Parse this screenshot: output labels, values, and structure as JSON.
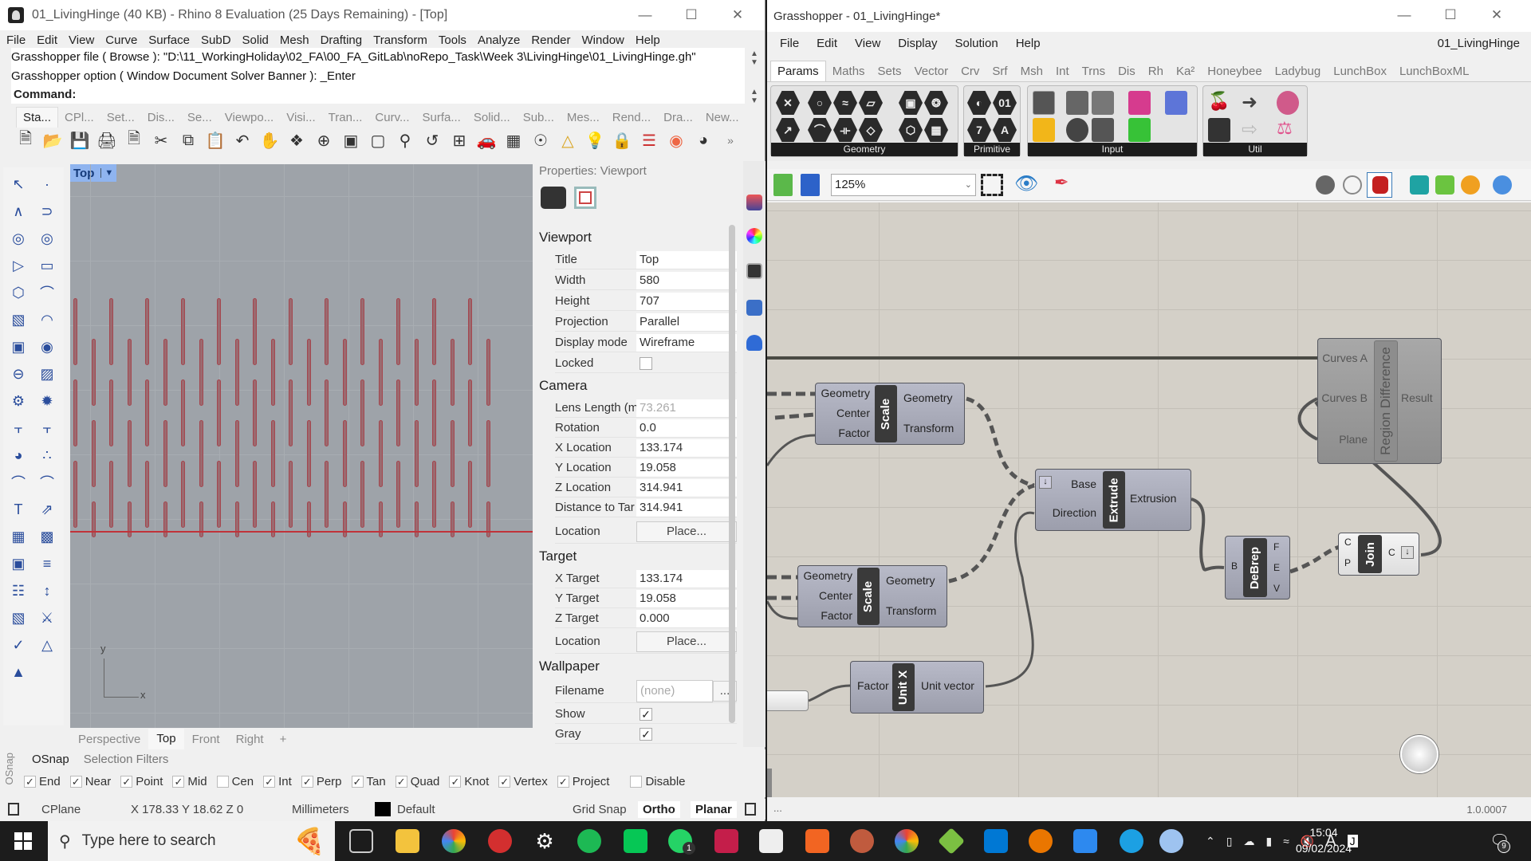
{
  "rhino": {
    "title": "01_LivingHinge (40 KB) - Rhino 8 Evaluation (25 Days Remaining) - [Top]",
    "menu": [
      "File",
      "Edit",
      "View",
      "Curve",
      "Surface",
      "SubD",
      "Solid",
      "Mesh",
      "Drafting",
      "Transform",
      "Tools",
      "Analyze",
      "Render",
      "Window",
      "Help"
    ],
    "command_history": [
      "Grasshopper file ( Browse ): \"D:\\11_WorkingHoliday\\02_FA\\00_FA_GitLab\\noRepo_Task\\Week 3\\LivingHinge\\01_LivingHinge.gh\"",
      "Grasshopper option ( Window  Document  Solver  Banner ): _Enter"
    ],
    "command_prompt": "Command:",
    "toolbar_tabs": [
      "Sta...",
      "CPl...",
      "Set...",
      "Dis...",
      "Se...",
      "Viewpo...",
      "Visi...",
      "Tran...",
      "Curv...",
      "Surfa...",
      "Solid...",
      "Sub...",
      "Mes...",
      "Rend...",
      "Dra...",
      "New..."
    ],
    "viewport": {
      "label": "Top",
      "axis_x": "x",
      "axis_y": "y"
    },
    "viewport_tabs": [
      "Perspective",
      "Top",
      "Front",
      "Right",
      "+"
    ],
    "properties": {
      "header": "Properties: Viewport",
      "sections": {
        "viewport": "Viewport",
        "camera": "Camera",
        "target": "Target",
        "wallpaper": "Wallpaper"
      },
      "title_label": "Title",
      "title": "Top",
      "width_label": "Width",
      "width": "580",
      "height_label": "Height",
      "height": "707",
      "projection_label": "Projection",
      "projection": "Parallel",
      "display_mode_label": "Display mode",
      "display_mode": "Wireframe",
      "locked_label": "Locked",
      "locked": false,
      "lens_label": "Lens Length (m",
      "lens": "73.261",
      "rotation_label": "Rotation",
      "rotation": "0.0",
      "xloc_label": "X Location",
      "xloc": "133.174",
      "yloc_label": "Y Location",
      "yloc": "19.058",
      "zloc_label": "Z Location",
      "zloc": "314.941",
      "dist_label": "Distance to Tar",
      "dist": "314.941",
      "location_label": "Location",
      "place": "Place...",
      "xt_label": "X Target",
      "xt": "133.174",
      "yt_label": "Y Target",
      "yt": "19.058",
      "zt_label": "Z Target",
      "zt": "0.000",
      "filename_label": "Filename",
      "filename": "(none)",
      "browse": "...",
      "show_label": "Show",
      "show": true,
      "gray_label": "Gray",
      "gray": true
    },
    "osnap": {
      "side_label": "OSnap",
      "tabs": [
        "OSnap",
        "Selection Filters"
      ],
      "items": [
        {
          "label": "End",
          "checked": true
        },
        {
          "label": "Near",
          "checked": true
        },
        {
          "label": "Point",
          "checked": true
        },
        {
          "label": "Mid",
          "checked": true
        },
        {
          "label": "Cen",
          "checked": false
        },
        {
          "label": "Int",
          "checked": true
        },
        {
          "label": "Perp",
          "checked": true
        },
        {
          "label": "Tan",
          "checked": true
        },
        {
          "label": "Quad",
          "checked": true
        },
        {
          "label": "Knot",
          "checked": true
        },
        {
          "label": "Vertex",
          "checked": true
        },
        {
          "label": "Project",
          "checked": true
        },
        {
          "label": "Disable",
          "checked": false
        }
      ]
    },
    "status": {
      "cplane": "CPlane",
      "coords": "X 178.33 Y 18.62 Z 0",
      "units": "Millimeters",
      "layer": "Default",
      "grid_snap": "Grid Snap",
      "ortho": "Ortho",
      "planar": "Planar"
    }
  },
  "grasshopper": {
    "title": "Grasshopper - 01_LivingHinge*",
    "menu": [
      "File",
      "Edit",
      "View",
      "Display",
      "Solution",
      "Help"
    ],
    "document_name": "01_LivingHinge",
    "tabs": [
      "Params",
      "Maths",
      "Sets",
      "Vector",
      "Crv",
      "Srf",
      "Msh",
      "Int",
      "Trns",
      "Dis",
      "Rh",
      "Ka²",
      "Honeybee",
      "Ladybug",
      "LunchBox",
      "LunchBoxML"
    ],
    "ribbon_groups": [
      "Geometry",
      "Primitive",
      "Input",
      "Util"
    ],
    "zoom": "125%",
    "components": {
      "scale1": {
        "name": "Scale",
        "inputs": [
          "Geometry",
          "Center",
          "Factor"
        ],
        "outputs": [
          "Geometry",
          "Transform"
        ]
      },
      "scale2": {
        "name": "Scale",
        "inputs": [
          "Geometry",
          "Center",
          "Factor"
        ],
        "outputs": [
          "Geometry",
          "Transform"
        ]
      },
      "extrude": {
        "name": "Extrude",
        "inputs": [
          "Base",
          "Direction"
        ],
        "outputs": [
          "Extrusion"
        ]
      },
      "unitx": {
        "name": "Unit X",
        "inputs": [
          "Factor"
        ],
        "outputs": [
          "Unit vector"
        ]
      },
      "regiondiff": {
        "name": "Region Difference",
        "inputs": [
          "Curves A",
          "Curves B",
          "Plane"
        ],
        "outputs": [
          "Result"
        ]
      },
      "debrep": {
        "name": "DeBrep",
        "inputs": [
          "B"
        ],
        "outputs": [
          "F",
          "E",
          "V"
        ]
      },
      "join": {
        "name": "Join",
        "inputs": [
          "C",
          "P"
        ],
        "outputs": [
          "C"
        ]
      }
    },
    "status_left": "...",
    "version": "1.0.0007"
  },
  "taskbar": {
    "search_placeholder": "Type here to search",
    "time": "15:04",
    "date": "09/02/2024",
    "notifications": "9",
    "whatsapp_badge": "1"
  }
}
